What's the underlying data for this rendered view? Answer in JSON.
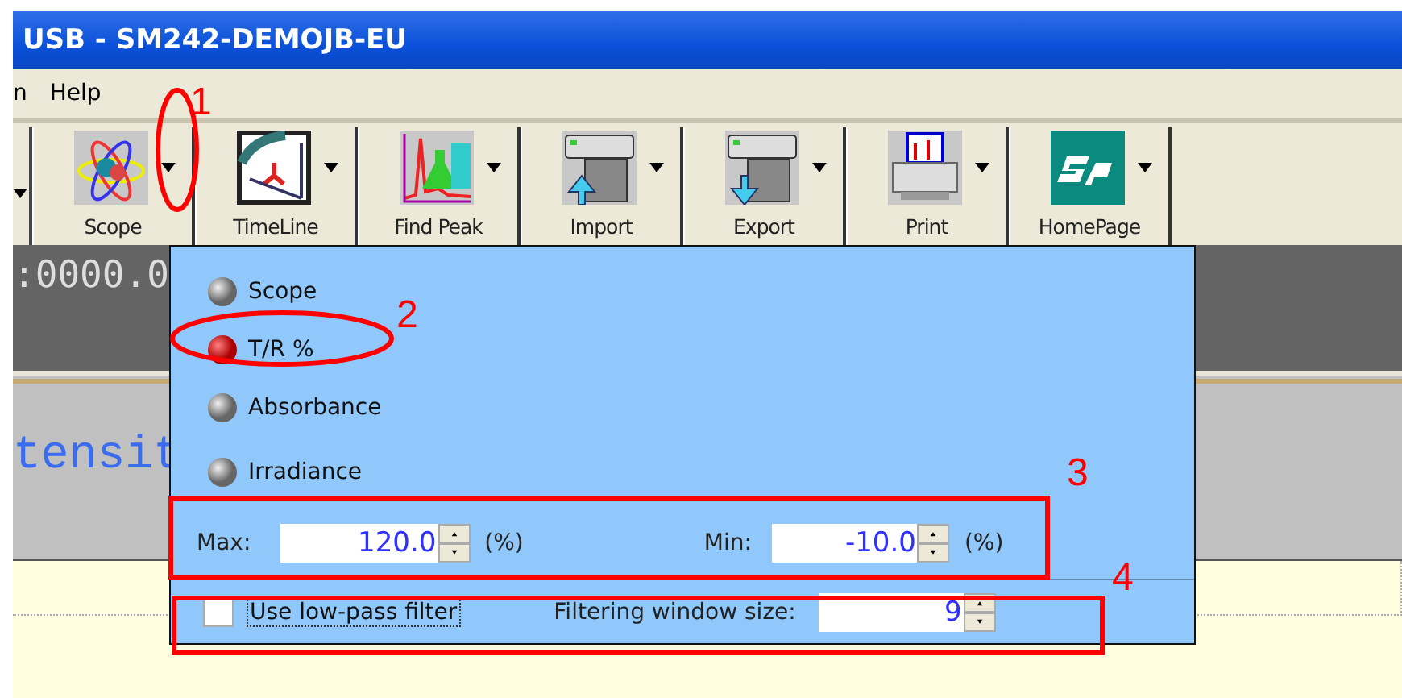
{
  "window": {
    "title": "USB - SM242-DEMOJB-EU"
  },
  "menu": [
    "n",
    "Help"
  ],
  "toolbar": [
    {
      "label": "Scope",
      "kind": "scope"
    },
    {
      "label": "TimeLine",
      "kind": "clock"
    },
    {
      "label": "Find Peak",
      "kind": "peak"
    },
    {
      "label": "Import",
      "kind": "import"
    },
    {
      "label": "Export",
      "kind": "export"
    },
    {
      "label": "Print",
      "kind": "print"
    },
    {
      "label": "HomePage",
      "kind": "home"
    }
  ],
  "readout": ":0000.0",
  "panel_label": "tensit",
  "popup": {
    "modes": [
      {
        "label": "Scope",
        "selected": false
      },
      {
        "label": "T/R %",
        "selected": true
      },
      {
        "label": "Absorbance",
        "selected": false
      },
      {
        "label": "Irradiance",
        "selected": false
      }
    ],
    "max": {
      "label": "Max:",
      "value": "120.0",
      "unit": "(%)"
    },
    "min": {
      "label": "Min:",
      "value": "-10.0",
      "unit": "(%)"
    },
    "filter": {
      "label": "Use low-pass filter",
      "checked": false
    },
    "window_size": {
      "label": "Filtering window size:",
      "value": "9"
    }
  },
  "annotations": [
    "1",
    "2",
    "3",
    "4"
  ]
}
